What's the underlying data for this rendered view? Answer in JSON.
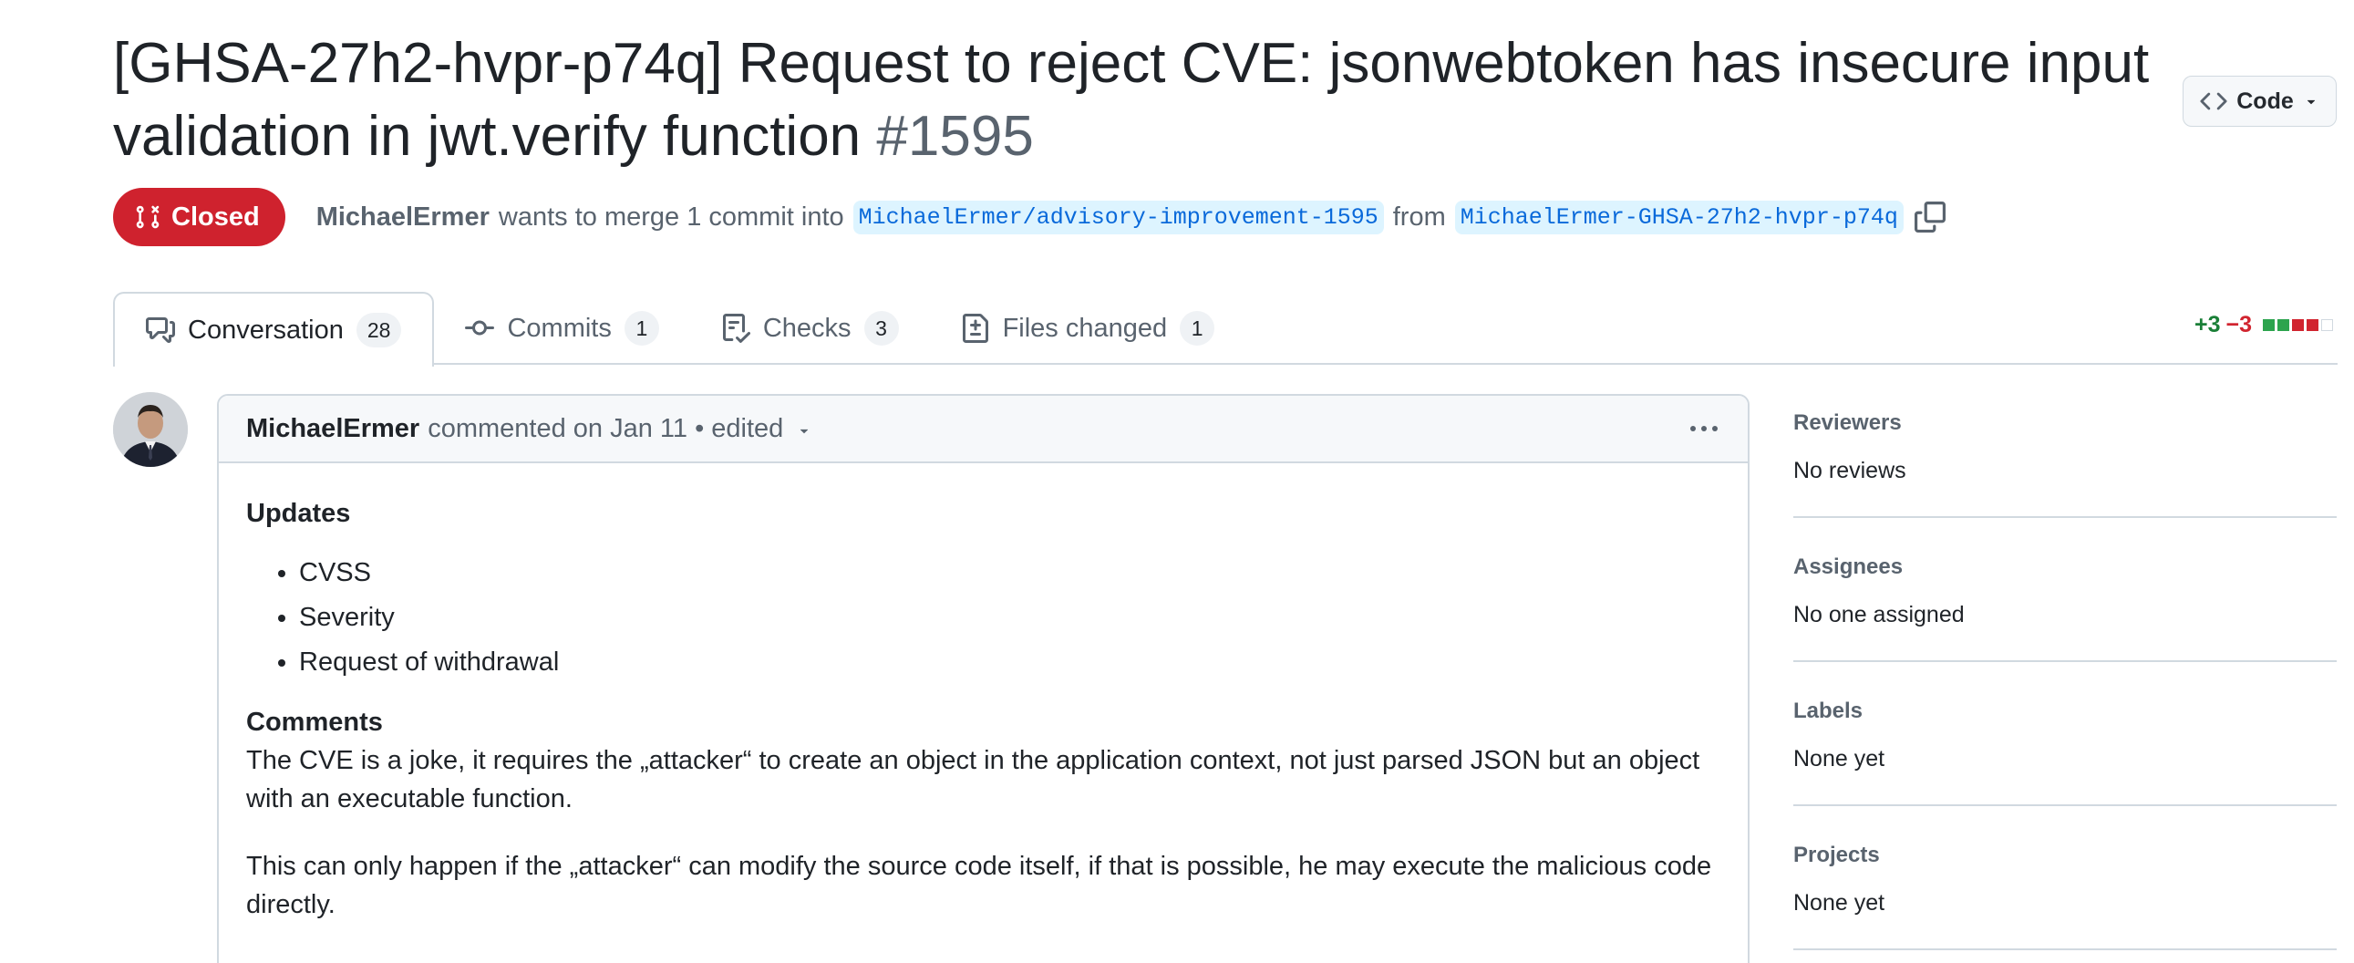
{
  "pr": {
    "title": "[GHSA-27h2-hvpr-p74q] Request to reject CVE: jsonwebtoken has insecure input validation in jwt.verify function",
    "number": "#1595",
    "state": "Closed",
    "author": "MichaelErmer",
    "merge_text": "wants to merge 1 commit into",
    "base_branch": "MichaelErmer/advisory-improvement-1595",
    "from_text": "from",
    "head_branch": "MichaelErmer-GHSA-27h2-hvpr-p74q"
  },
  "code_button": {
    "label": "Code"
  },
  "tabs": [
    {
      "label": "Conversation",
      "count": "28",
      "icon": "comment-discussion-icon"
    },
    {
      "label": "Commits",
      "count": "1",
      "icon": "git-commit-icon"
    },
    {
      "label": "Checks",
      "count": "3",
      "icon": "checklist-icon"
    },
    {
      "label": "Files changed",
      "count": "1",
      "icon": "file-diff-icon"
    }
  ],
  "diffstat": {
    "additions": "+3",
    "deletions": "−3"
  },
  "comment": {
    "author": "MichaelErmer",
    "meta": "commented on Jan 11 • edited",
    "heading_updates": "Updates",
    "updates": [
      "CVSS",
      "Severity",
      "Request of withdrawal"
    ],
    "heading_comments": "Comments",
    "paragraph1": "The CVE is a joke, it requires the „attacker“ to create an object in the application context, not just parsed JSON but an object with an executable function.",
    "paragraph2": "This can only happen if the „attacker“ can modify the source code itself, if that is possible, he may execute the malicious code directly."
  },
  "sidebar": {
    "reviewers": {
      "title": "Reviewers",
      "value": "No reviews"
    },
    "assignees": {
      "title": "Assignees",
      "value": "No one assigned"
    },
    "labels": {
      "title": "Labels",
      "value": "None yet"
    },
    "projects": {
      "title": "Projects",
      "value": "None yet"
    }
  },
  "colors": {
    "closed_state": "#cf222e",
    "branch_text": "#0969da",
    "branch_bg": "#ddf4ff",
    "additions": "#1a7f37",
    "deletions": "#d1242f"
  }
}
